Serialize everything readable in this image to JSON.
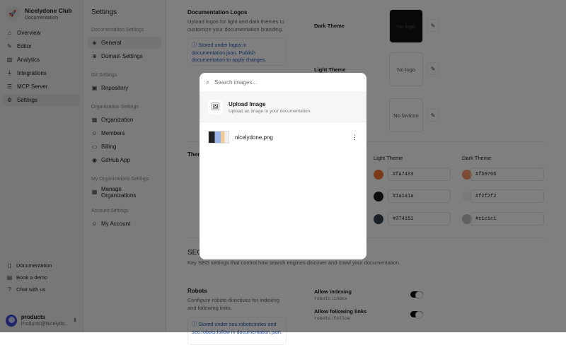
{
  "org": {
    "name": "Nicelydone Club",
    "subtitle": "Documentation"
  },
  "nav": [
    "Overview",
    "Editor",
    "Analytics",
    "Integrations",
    "MCP Server",
    "Settings"
  ],
  "footer": [
    "Documentation",
    "Book a demo",
    "Chat with us"
  ],
  "user": {
    "name": "products",
    "email": "Products@Nicelydo..."
  },
  "settings": {
    "title": "Settings",
    "groups": [
      {
        "label": "Documentation Settings",
        "items": [
          "General",
          "Domain Settings"
        ]
      },
      {
        "label": "Git Settings",
        "items": [
          "Repository"
        ]
      },
      {
        "label": "Organization Settings",
        "items": [
          "Organization",
          "Members",
          "Billing",
          "GitHub App"
        ]
      },
      {
        "label": "My Organizations Settings",
        "items": [
          "Manage Organizations"
        ]
      },
      {
        "label": "Account Settings",
        "items": [
          "My Account"
        ]
      }
    ]
  },
  "logos": {
    "title": "Documentation Logos",
    "desc": "Upload logos for light and dark themes to customize your documentation branding.",
    "info": "Stored under logos in documentation.json. Publish documentation to apply changes.",
    "dark_label": "Dark Theme",
    "light_label": "Light Theme",
    "no_logo": "No logo",
    "no_favicon": "No favicon"
  },
  "theme": {
    "title": "Them",
    "light_header": "Light Theme",
    "dark_header": "Dark Theme",
    "light": [
      "#fa7433",
      "#1a1a1a",
      "#374151"
    ],
    "dark": [
      "#fb9766",
      "#f2f2f2",
      "#c1c1c1"
    ]
  },
  "seo": {
    "title": "SEO",
    "desc": "Key SEO settings that control how search engines discover and crawl your documentation."
  },
  "robots": {
    "title": "Robots",
    "desc": "Configure robots directives for indexing and following links.",
    "info": "Stored under seo.robots:index and seo.robots:follow in documentation.json.",
    "index_label": "Allow indexing",
    "index_code": "robots:index",
    "follow_label": "Allow following links",
    "follow_code": "robots:follow",
    "index_on": true,
    "follow_on": true
  },
  "modal": {
    "search_placeholder": "Search images...",
    "upload_title": "Upload Image",
    "upload_desc": "Upload an image to your documentation",
    "file": "nicelydone.png"
  }
}
